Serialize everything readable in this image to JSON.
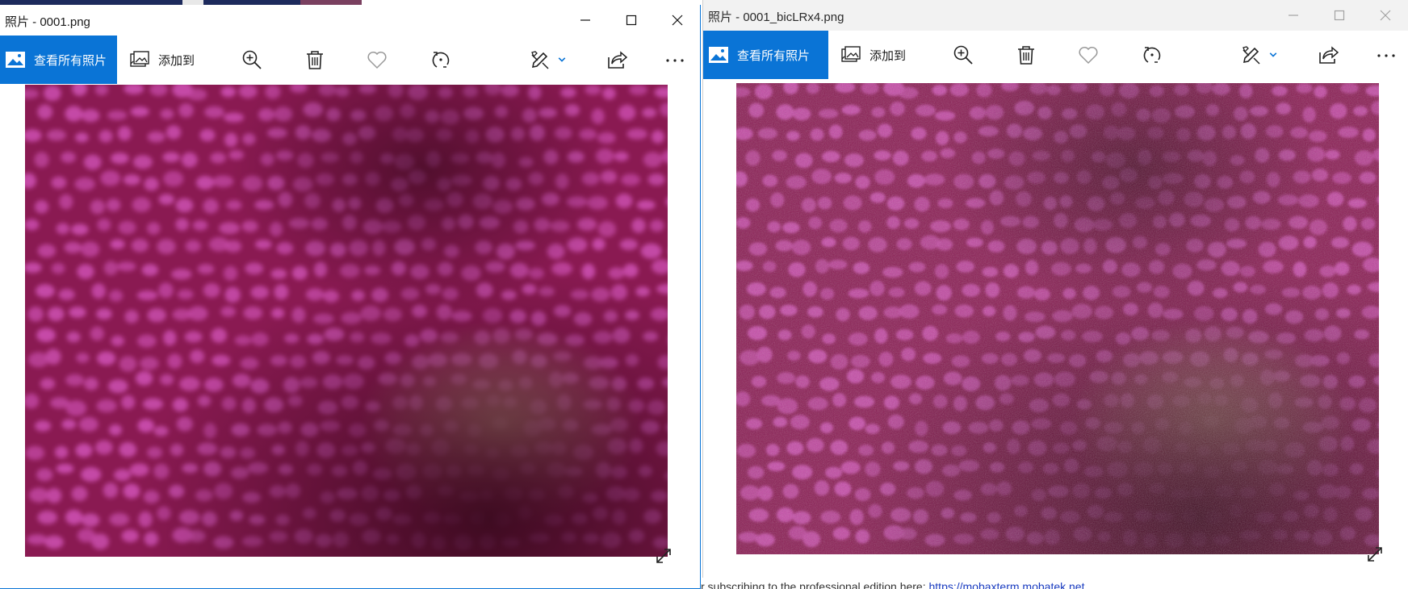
{
  "left_window": {
    "title": "照片 - 0001.png",
    "active": true,
    "toolbar": {
      "view_all": "查看所有照片",
      "add_to": "添加到"
    },
    "icons": [
      "photos-icon",
      "add-to-icon",
      "zoom-in-icon",
      "delete-icon",
      "favorite-icon",
      "rotate-icon",
      "edit-icon",
      "dropdown-chevron-icon",
      "share-icon",
      "more-icon",
      "expand-icon"
    ]
  },
  "right_window": {
    "title": "照片 - 0001_bicLRx4.png",
    "active": false,
    "toolbar": {
      "view_all": "查看所有照片",
      "add_to": "添加到"
    }
  },
  "colors": {
    "accent": "#0a74d6",
    "photo_base": "#8a1a52",
    "photo_spot": "#c64aa8",
    "photo_dark": "#3a0a1e",
    "photo_light": "#b49a7a"
  },
  "background": {
    "bottom_text": "r subscribing to the professional edition here: ",
    "bottom_link": "https://mobaxterm.mobatek.net"
  }
}
